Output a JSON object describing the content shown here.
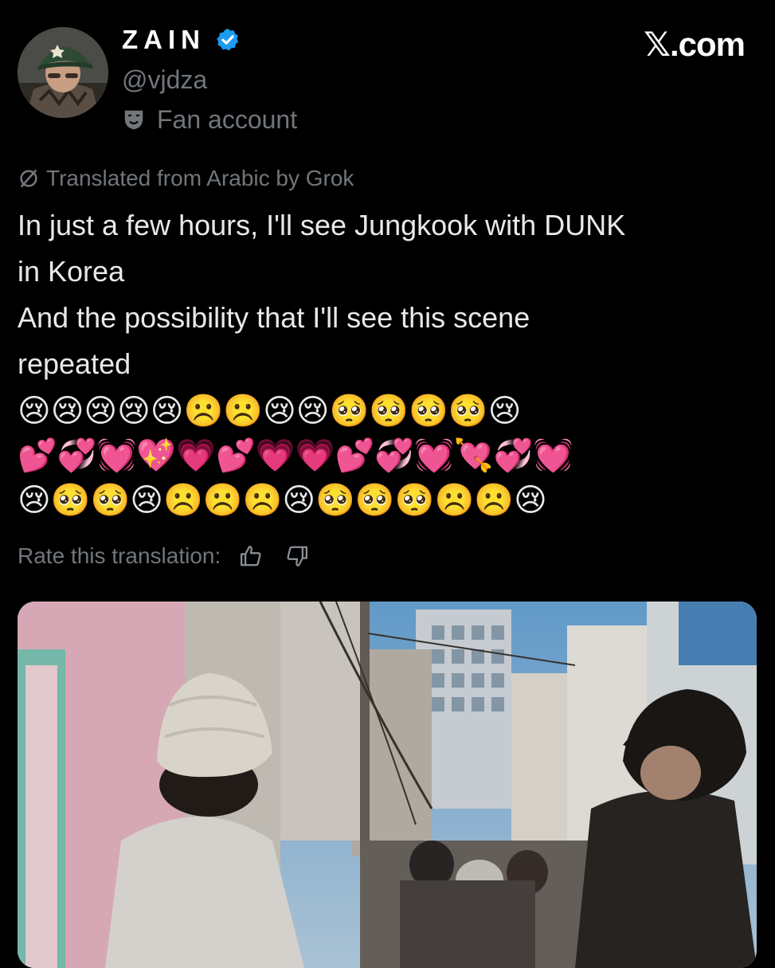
{
  "author": {
    "display_name": "ZAIN",
    "handle": "@vjdza",
    "verified_icon": "verified-badge-icon",
    "affiliation": "Fan account",
    "affiliation_icon": "theater-mask-icon"
  },
  "brand": {
    "label": "𝕏.com"
  },
  "translation": {
    "note": "Translated from Arabic by Grok",
    "icon": "slashed-circle-icon"
  },
  "tweet": {
    "lines": [
      "In just a few hours, I'll see Jungkook with DUNK",
      "in Korea",
      "And the possibility that I'll see this scene",
      "repeated"
    ],
    "emoji_rows": [
      "😢😢😢😢😢☹️☹️😢😢🥺🥺🥺🥺😢",
      "💕💞💓💖💗💕💗💗💕💞💓💘💞💓",
      "😢🥺🥺😢☹️☹️☹️😢🥺🥺🥺☹️☹️😢"
    ]
  },
  "rating": {
    "label": "Rate this translation:",
    "thumbs_up_icon": "thumbs-up-icon",
    "thumbs_down_icon": "thumbs-down-icon"
  },
  "colors": {
    "background": "#000000",
    "text": "#e7e9ea",
    "muted": "#71767b",
    "verified": "#1d9bf0"
  }
}
